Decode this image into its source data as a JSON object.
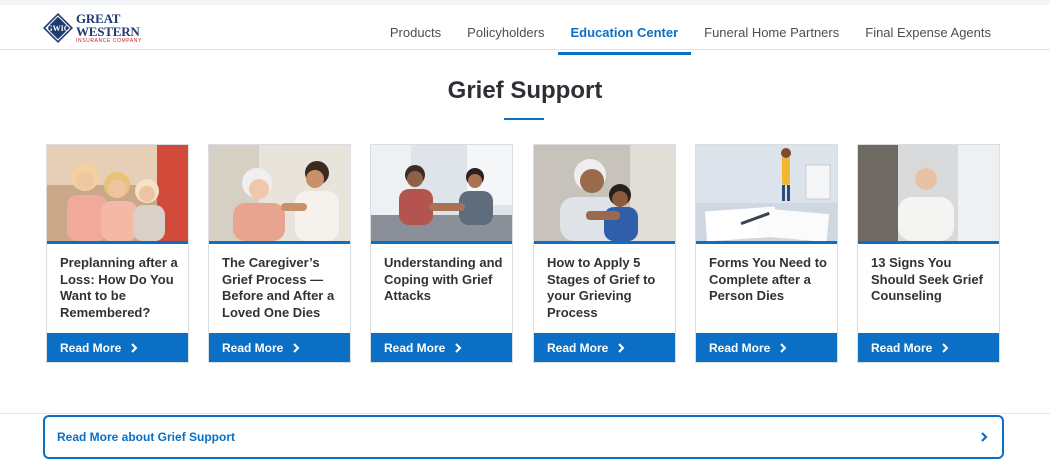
{
  "brand": {
    "monogram": "GWIC",
    "name": "GREAT WESTERN",
    "tagline": "INSURANCE COMPANY",
    "color_primary": "#1f3a6e",
    "color_accent": "#c1272d"
  },
  "nav": {
    "items": [
      {
        "label": "Products"
      },
      {
        "label": "Policyholders"
      },
      {
        "label": "Education Center",
        "active": true
      },
      {
        "label": "Funeral Home Partners"
      },
      {
        "label": "Final Expense Agents"
      }
    ]
  },
  "section": {
    "title": "Grief Support"
  },
  "cards": [
    {
      "title": "Preplanning after a Loss: How Do You Want to be Remembered?",
      "button": "Read More",
      "image_icon": "family-photo-icon"
    },
    {
      "title": "The Caregiver’s Grief Process — Before and After a Loved One Dies",
      "button": "Read More",
      "image_icon": "caregiver-photo-icon"
    },
    {
      "title": "Understanding and Coping with Grief Attacks",
      "button": "Read More",
      "image_icon": "conversation-photo-icon"
    },
    {
      "title": "How to Apply 5 Stages of Grief to your Grieving Process",
      "button": "Read More",
      "image_icon": "hug-photo-icon"
    },
    {
      "title": "Forms You Need to Complete after a Person Dies",
      "button": "Read More",
      "image_icon": "paperwork-photo-icon"
    },
    {
      "title": "13 Signs You Should Seek Grief Counseling",
      "button": "Read More",
      "image_icon": "elderly-woman-photo-icon"
    }
  ],
  "footer_link": {
    "label": "Read More about Grief Support"
  },
  "colors": {
    "accent_blue": "#0b6fc6",
    "text_dark": "#2f3337"
  }
}
